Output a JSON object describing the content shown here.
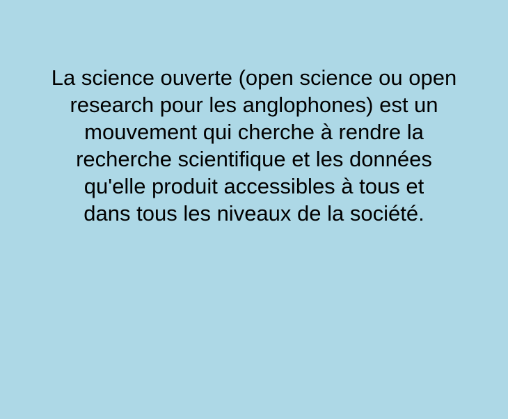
{
  "slide": {
    "background_color": "#add8e6",
    "text_color": "#000000",
    "paragraph_lines": [
      "La science ouverte (open science ou open",
      "research pour les anglophones) est un",
      "mouvement qui cherche à rendre la",
      "recherche scientifique et les données",
      "qu'elle produit accessibles à tous et",
      "dans tous les niveaux de la société."
    ]
  }
}
